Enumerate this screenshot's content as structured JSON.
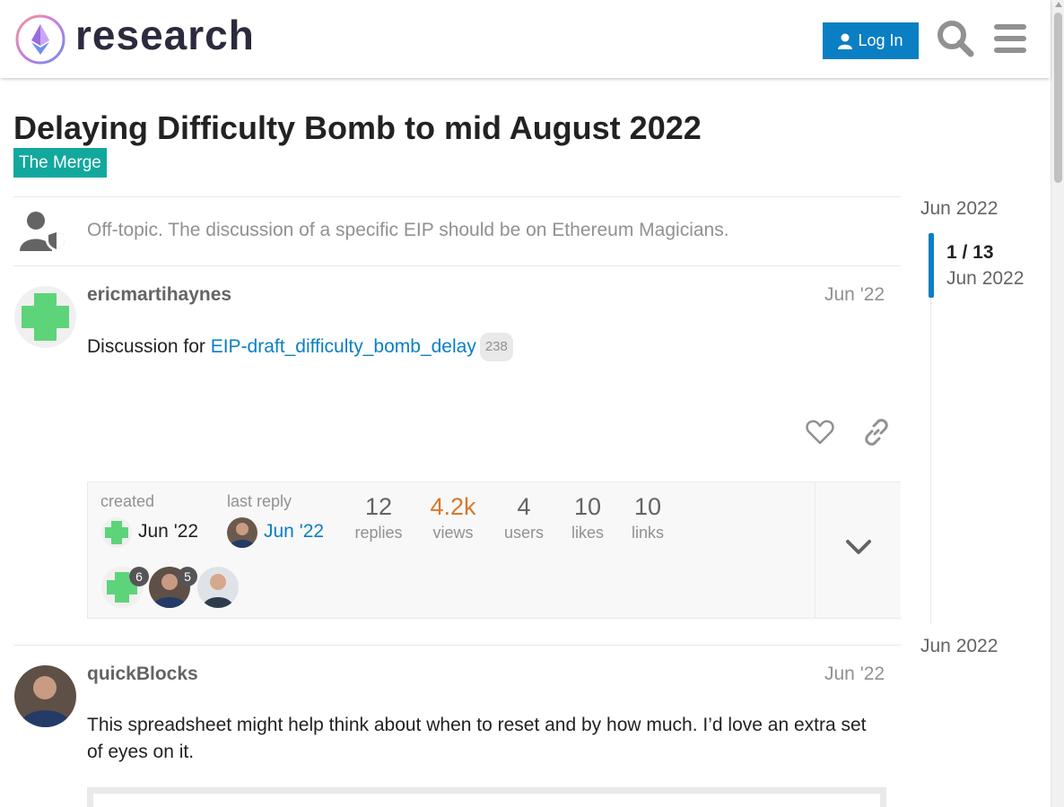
{
  "header": {
    "brand": "research",
    "login_label": "Log In"
  },
  "topic": {
    "title": "Delaying Difficulty Bomb to mid August 2022",
    "category": "The Merge",
    "category_color": "#12a89d"
  },
  "small_action": {
    "text": "Off-topic. The discussion of a specific EIP should be on Ethereum Magicians."
  },
  "posts": [
    {
      "username": "ericmartihaynes",
      "date": "Jun '22",
      "body_prefix": "Discussion for ",
      "link_text": "EIP-draft_difficulty_bomb_delay",
      "link_clicks": "238"
    },
    {
      "username": "quickBlocks",
      "date": "Jun '22",
      "body": "This spreadsheet might help think about when to reset and by how much. I’d love an extra set of eyes on it."
    }
  ],
  "topic_map": {
    "created_label": "created",
    "created_date": "Jun '22",
    "last_reply_label": "last reply",
    "last_reply_date": "Jun '22",
    "stats": [
      {
        "value": "12",
        "label": "replies"
      },
      {
        "value": "4.2k",
        "label": "views"
      },
      {
        "value": "4",
        "label": "users"
      },
      {
        "value": "10",
        "label": "likes"
      },
      {
        "value": "10",
        "label": "links"
      }
    ],
    "participants": [
      {
        "count": "6"
      },
      {
        "count": "5"
      },
      {
        "count": ""
      }
    ]
  },
  "timeline": {
    "top_date": "Jun 2022",
    "position": "1 / 13",
    "position_date": "Jun 2022",
    "bottom_date": "Jun 2022"
  },
  "colors": {
    "accent": "#0a7fc3",
    "views_highlight": "#d9772b",
    "avatar_green": "#5dd47a"
  }
}
